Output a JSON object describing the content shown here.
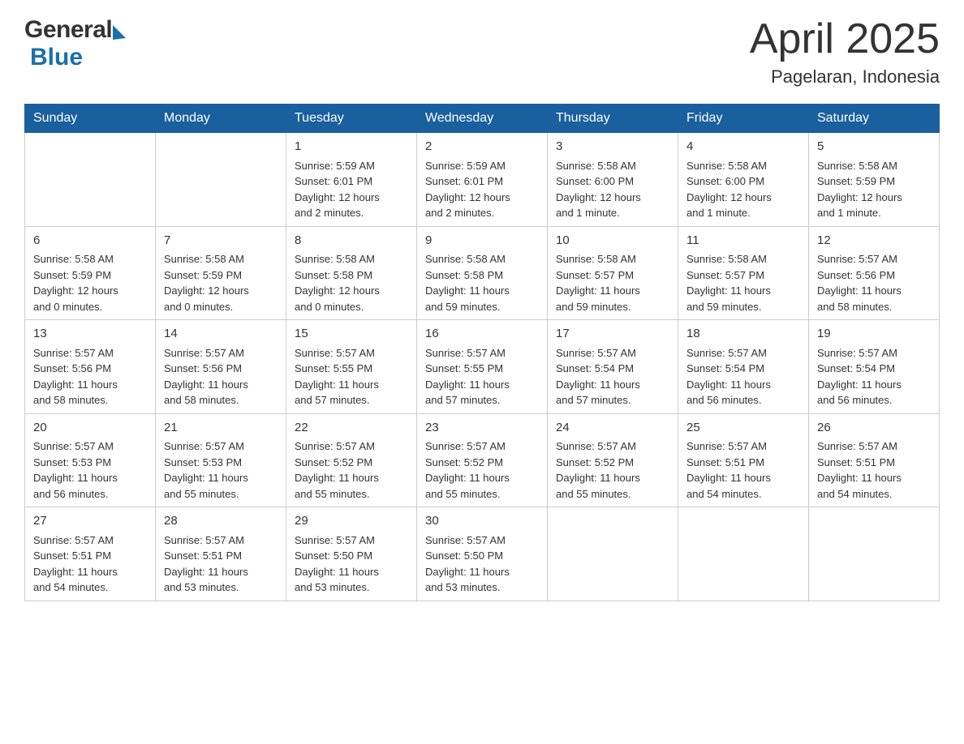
{
  "header": {
    "logo_general": "General",
    "logo_blue": "Blue",
    "main_title": "April 2025",
    "subtitle": "Pagelaran, Indonesia"
  },
  "days_of_week": [
    "Sunday",
    "Monday",
    "Tuesday",
    "Wednesday",
    "Thursday",
    "Friday",
    "Saturday"
  ],
  "weeks": [
    [
      {
        "day": "",
        "info": ""
      },
      {
        "day": "",
        "info": ""
      },
      {
        "day": "1",
        "info": "Sunrise: 5:59 AM\nSunset: 6:01 PM\nDaylight: 12 hours\nand 2 minutes."
      },
      {
        "day": "2",
        "info": "Sunrise: 5:59 AM\nSunset: 6:01 PM\nDaylight: 12 hours\nand 2 minutes."
      },
      {
        "day": "3",
        "info": "Sunrise: 5:58 AM\nSunset: 6:00 PM\nDaylight: 12 hours\nand 1 minute."
      },
      {
        "day": "4",
        "info": "Sunrise: 5:58 AM\nSunset: 6:00 PM\nDaylight: 12 hours\nand 1 minute."
      },
      {
        "day": "5",
        "info": "Sunrise: 5:58 AM\nSunset: 5:59 PM\nDaylight: 12 hours\nand 1 minute."
      }
    ],
    [
      {
        "day": "6",
        "info": "Sunrise: 5:58 AM\nSunset: 5:59 PM\nDaylight: 12 hours\nand 0 minutes."
      },
      {
        "day": "7",
        "info": "Sunrise: 5:58 AM\nSunset: 5:59 PM\nDaylight: 12 hours\nand 0 minutes."
      },
      {
        "day": "8",
        "info": "Sunrise: 5:58 AM\nSunset: 5:58 PM\nDaylight: 12 hours\nand 0 minutes."
      },
      {
        "day": "9",
        "info": "Sunrise: 5:58 AM\nSunset: 5:58 PM\nDaylight: 11 hours\nand 59 minutes."
      },
      {
        "day": "10",
        "info": "Sunrise: 5:58 AM\nSunset: 5:57 PM\nDaylight: 11 hours\nand 59 minutes."
      },
      {
        "day": "11",
        "info": "Sunrise: 5:58 AM\nSunset: 5:57 PM\nDaylight: 11 hours\nand 59 minutes."
      },
      {
        "day": "12",
        "info": "Sunrise: 5:57 AM\nSunset: 5:56 PM\nDaylight: 11 hours\nand 58 minutes."
      }
    ],
    [
      {
        "day": "13",
        "info": "Sunrise: 5:57 AM\nSunset: 5:56 PM\nDaylight: 11 hours\nand 58 minutes."
      },
      {
        "day": "14",
        "info": "Sunrise: 5:57 AM\nSunset: 5:56 PM\nDaylight: 11 hours\nand 58 minutes."
      },
      {
        "day": "15",
        "info": "Sunrise: 5:57 AM\nSunset: 5:55 PM\nDaylight: 11 hours\nand 57 minutes."
      },
      {
        "day": "16",
        "info": "Sunrise: 5:57 AM\nSunset: 5:55 PM\nDaylight: 11 hours\nand 57 minutes."
      },
      {
        "day": "17",
        "info": "Sunrise: 5:57 AM\nSunset: 5:54 PM\nDaylight: 11 hours\nand 57 minutes."
      },
      {
        "day": "18",
        "info": "Sunrise: 5:57 AM\nSunset: 5:54 PM\nDaylight: 11 hours\nand 56 minutes."
      },
      {
        "day": "19",
        "info": "Sunrise: 5:57 AM\nSunset: 5:54 PM\nDaylight: 11 hours\nand 56 minutes."
      }
    ],
    [
      {
        "day": "20",
        "info": "Sunrise: 5:57 AM\nSunset: 5:53 PM\nDaylight: 11 hours\nand 56 minutes."
      },
      {
        "day": "21",
        "info": "Sunrise: 5:57 AM\nSunset: 5:53 PM\nDaylight: 11 hours\nand 55 minutes."
      },
      {
        "day": "22",
        "info": "Sunrise: 5:57 AM\nSunset: 5:52 PM\nDaylight: 11 hours\nand 55 minutes."
      },
      {
        "day": "23",
        "info": "Sunrise: 5:57 AM\nSunset: 5:52 PM\nDaylight: 11 hours\nand 55 minutes."
      },
      {
        "day": "24",
        "info": "Sunrise: 5:57 AM\nSunset: 5:52 PM\nDaylight: 11 hours\nand 55 minutes."
      },
      {
        "day": "25",
        "info": "Sunrise: 5:57 AM\nSunset: 5:51 PM\nDaylight: 11 hours\nand 54 minutes."
      },
      {
        "day": "26",
        "info": "Sunrise: 5:57 AM\nSunset: 5:51 PM\nDaylight: 11 hours\nand 54 minutes."
      }
    ],
    [
      {
        "day": "27",
        "info": "Sunrise: 5:57 AM\nSunset: 5:51 PM\nDaylight: 11 hours\nand 54 minutes."
      },
      {
        "day": "28",
        "info": "Sunrise: 5:57 AM\nSunset: 5:51 PM\nDaylight: 11 hours\nand 53 minutes."
      },
      {
        "day": "29",
        "info": "Sunrise: 5:57 AM\nSunset: 5:50 PM\nDaylight: 11 hours\nand 53 minutes."
      },
      {
        "day": "30",
        "info": "Sunrise: 5:57 AM\nSunset: 5:50 PM\nDaylight: 11 hours\nand 53 minutes."
      },
      {
        "day": "",
        "info": ""
      },
      {
        "day": "",
        "info": ""
      },
      {
        "day": "",
        "info": ""
      }
    ]
  ]
}
